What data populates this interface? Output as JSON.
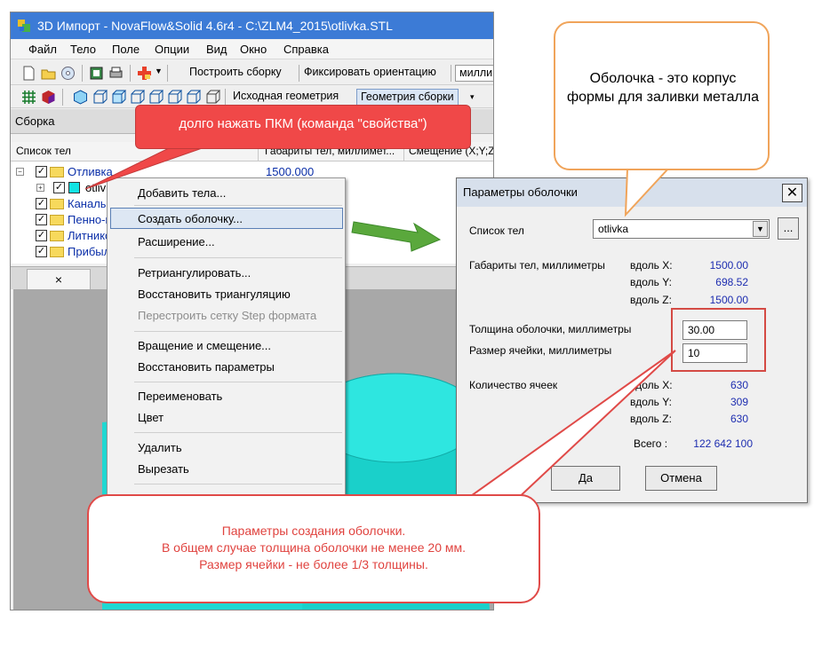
{
  "window": {
    "title": "3D Импорт - NovaFlow&Solid 4.6r4 - C:\\ZLM4_2015\\otlivka.STL"
  },
  "menu": [
    "Файл",
    "Тело",
    "Поле",
    "Опции",
    "Вид",
    "Окно",
    "Справка"
  ],
  "toolbar1": {
    "build_assembly": "Построить сборку",
    "fix_orientation": "Фиксировать ориентацию",
    "units": "милли"
  },
  "toolbar2": {
    "source_geometry": "Исходная геометрия",
    "assembly_geometry": "Геометрия сборки"
  },
  "panel": {
    "title": "Сборка",
    "columns": [
      "Список тел",
      "Габариты тел, миллимет...",
      "Смещение (X;Y;Z"
    ]
  },
  "tree": [
    {
      "label": "Отливка",
      "value": "1500.000"
    },
    {
      "label": "otlivka",
      "value": ""
    },
    {
      "label": "Каналы",
      "value": ""
    },
    {
      "label": "Пенно-к",
      "value": ""
    },
    {
      "label": "Литнико",
      "value": ""
    },
    {
      "label": "Прибыл",
      "value": ""
    }
  ],
  "tab_close": "×",
  "context_menu": {
    "items": [
      "Добавить тела...",
      "Создать оболочку...",
      "Расширение...",
      "Ретриангулировать...",
      "Восстановить триангуляцию",
      "Перестроить сетку Step формата",
      "Вращение и смещение...",
      "Восстановить параметры",
      "Переименовать",
      "Цвет",
      "Удалить",
      "Вырезать"
    ],
    "highlighted": "Создать оболочку..."
  },
  "dialog": {
    "title": "Параметры оболочки",
    "body_list_label": "Список тел",
    "body_list_value": "otlivka",
    "browse": "...",
    "dims_label": "Габариты тел, миллиметры",
    "along_x": "вдоль X:",
    "along_y": "вдоль Y:",
    "along_z": "вдоль Z:",
    "dim_x": "1500.00",
    "dim_y": "698.52",
    "dim_z": "1500.00",
    "shell_thickness_label": "Толщина оболочки, миллиметры",
    "shell_thickness": "30.00",
    "cell_size_label": "Размер ячейки, миллиметры",
    "cell_size": "10",
    "cells_label": "Количество ячеек",
    "cells_x": "630",
    "cells_y": "309",
    "cells_z": "630",
    "total_label": "Всего :",
    "total": "122 642 100",
    "ok": "Да",
    "cancel": "Отмена"
  },
  "callouts": {
    "top": "долго нажать ПКМ (команда \"свойства\")",
    "right": "Оболочка - это корпус формы для заливки металла",
    "bottom_line1": "Параметры создания оболочки.",
    "bottom_line2": "В общем случае толщина оболочки не менее 20 мм.",
    "bottom_line3": "Размер ячейки - не более 1/3 толщины."
  },
  "colors": {
    "title_bar": "#3c7bd6",
    "shape": "#1fd8d2",
    "callout_red": "#f04848",
    "callout_orange": "#f0a45a",
    "arrow_green": "#5aa83c",
    "value_blue": "#1d2db0"
  }
}
